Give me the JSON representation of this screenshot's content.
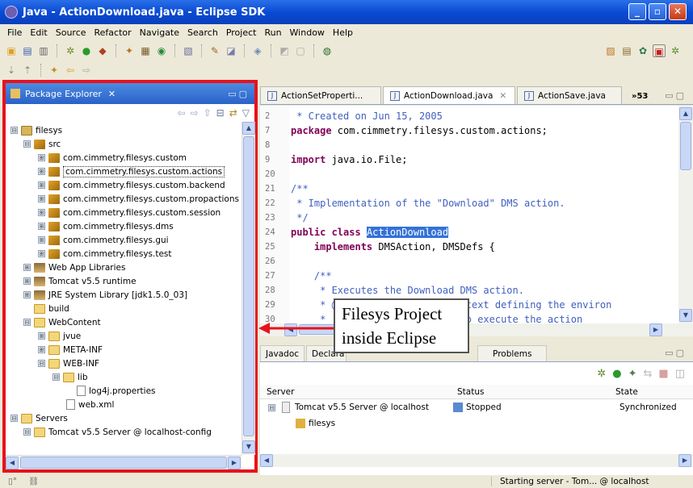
{
  "window": {
    "title": "Java - ActionDownload.java - Eclipse SDK",
    "min": "_",
    "max": "▫",
    "close": "✕"
  },
  "menu": [
    "File",
    "Edit",
    "Source",
    "Refactor",
    "Navigate",
    "Search",
    "Project",
    "Run",
    "Window",
    "Help"
  ],
  "package_explorer": {
    "title": "Package Explorer",
    "close": "✕",
    "tree": [
      {
        "label": "filesys",
        "exp": "⊟"
      },
      {
        "label": "src",
        "exp": "⊟"
      },
      {
        "label": "com.cimmetry.filesys.custom",
        "exp": "⊞"
      },
      {
        "label": "com.cimmetry.filesys.custom.actions",
        "exp": "⊞"
      },
      {
        "label": "com.cimmetry.filesys.custom.backend",
        "exp": "⊞"
      },
      {
        "label": "com.cimmetry.filesys.custom.propactions",
        "exp": "⊞"
      },
      {
        "label": "com.cimmetry.filesys.custom.session",
        "exp": "⊞"
      },
      {
        "label": "com.cimmetry.filesys.dms",
        "exp": "⊞"
      },
      {
        "label": "com.cimmetry.filesys.gui",
        "exp": "⊞"
      },
      {
        "label": "com.cimmetry.filesys.test",
        "exp": "⊞"
      },
      {
        "label": "Web App Libraries",
        "exp": "⊞"
      },
      {
        "label": "Tomcat v5.5 runtime",
        "exp": "⊞"
      },
      {
        "label": "JRE System Library [jdk1.5.0_03]",
        "exp": "⊞"
      },
      {
        "label": "build",
        "exp": ""
      },
      {
        "label": "WebContent",
        "exp": "⊟"
      },
      {
        "label": "jvue",
        "exp": "⊞"
      },
      {
        "label": "META-INF",
        "exp": "⊞"
      },
      {
        "label": "WEB-INF",
        "exp": "⊟"
      },
      {
        "label": "lib",
        "exp": "⊟"
      },
      {
        "label": "log4j.properties",
        "exp": ""
      },
      {
        "label": "web.xml",
        "exp": ""
      },
      {
        "label": "Servers",
        "exp": "⊟"
      },
      {
        "label": "Tomcat v5.5 Server @ localhost-config",
        "exp": "⊟"
      }
    ]
  },
  "editor": {
    "tabs": [
      "ActionSetProperti...",
      "ActionDownload.java",
      "ActionSave.java"
    ],
    "active_tab_close": "✕",
    "more_tabs": "»53",
    "line_numbers": [
      "2",
      "7",
      "8",
      "9",
      "20",
      "21",
      "22",
      "23",
      "24",
      "25",
      "26",
      "27",
      "28",
      "29",
      "30"
    ],
    "code": {
      "l1": " * Created on Jun 15, 2005",
      "l2_kw": "package",
      "l2": " com.cimmetry.filesys.custom.actions;",
      "l4_kw": "import",
      "l4": " java.io.File;",
      "l6": "/**",
      "l7": " * Implementation of the \"Download\" DMS action.",
      "l8": " */",
      "l9_kw": "public class",
      "l9_hl": "ActionDownload",
      "l10_kw": "    implements",
      "l10": " DMSAction, DMSDefs {",
      "l12": "    /**",
      "l13": "     * Executes the Download DMS action.",
      "l14": "     * @param context [in] context defining the environ",
      "l15": "     *                       to execute the action"
    }
  },
  "callout": {
    "line1": "Filesys Project",
    "line2": "inside Eclipse"
  },
  "bottom": {
    "tabs": [
      "Javadoc",
      "Declara",
      "Problems"
    ],
    "columns": [
      "Server",
      "Status",
      "State"
    ],
    "server_name": "Tomcat v5.5 Server @ localhost",
    "server_status": "Stopped",
    "server_state": "Synchronized",
    "child": "filesys"
  },
  "status_bar": {
    "message": "Starting server - Tom... @ localhost"
  },
  "colors": {
    "highlight_border": "#e8121b",
    "title_blue": "#0a4bd4",
    "keyword": "#7f0055",
    "comment": "#3f5fbf"
  }
}
